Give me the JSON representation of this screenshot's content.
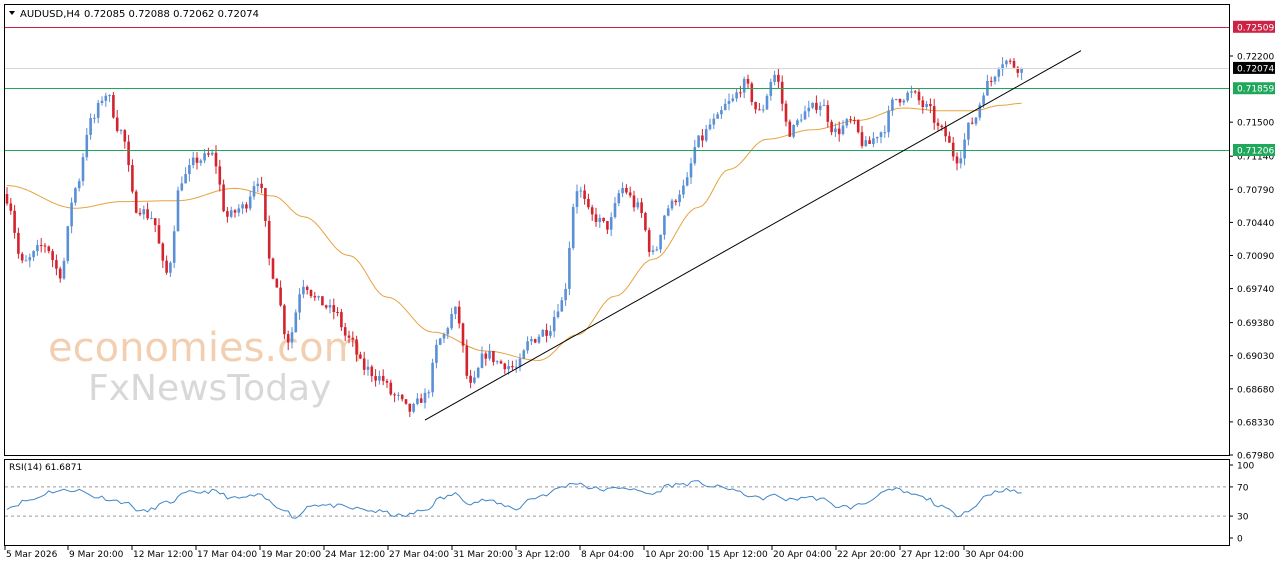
{
  "header": {
    "symbol": "AUDUSD,H4",
    "ohlc": "0.72085 0.72088 0.72062 0.72074"
  },
  "watermark": {
    "line1": "economies.com",
    "line2": "FxNewsToday"
  },
  "colors": {
    "bull": "#5b8fd6",
    "bear": "#d3232d",
    "ma": "#e7a23f",
    "rsi": "#3f86c6",
    "resistance": "#cc2244",
    "support": "#1fa85b",
    "trendline": "#000000",
    "grid": "#d7d7d7",
    "current": "#000000"
  },
  "chart_data": [
    {
      "type": "candlestick",
      "title": "AUDUSD,H4",
      "y_ticks": [
        "0.72200",
        "0.71500",
        "0.71140",
        "0.70790",
        "0.70440",
        "0.70090",
        "0.69740",
        "0.69380",
        "0.69030",
        "0.68680",
        "0.68330",
        "0.67980"
      ],
      "ylim": [
        0.6798,
        0.7275
      ],
      "x_ticks": [
        "5 Mar 2026",
        "9 Mar 20:00",
        "12 Mar 12:00",
        "17 Mar 04:00",
        "19 Mar 20:00",
        "24 Mar 12:00",
        "27 Mar 04:00",
        "31 Mar 20:00",
        "3 Apr 12:00",
        "8 Apr 04:00",
        "10 Apr 20:00",
        "15 Apr 12:00",
        "20 Apr 04:00",
        "22 Apr 20:00",
        "27 Apr 12:00",
        "30 Apr 04:00"
      ],
      "price_levels": [
        {
          "label": "0.72509",
          "value": 0.72509,
          "kind": "resistance"
        },
        {
          "label": "0.72074",
          "value": 0.72074,
          "kind": "current"
        },
        {
          "label": "0.71859",
          "value": 0.71859,
          "kind": "support"
        },
        {
          "label": "0.71206",
          "value": 0.71206,
          "kind": "support"
        }
      ],
      "trendline": {
        "from": {
          "bar": 110,
          "price": 0.6835
        },
        "to": {
          "bar": 266,
          "price": 0.7188
        }
      },
      "moving_average_anchors": [
        [
          0,
          0.7083
        ],
        [
          18,
          0.7059
        ],
        [
          30,
          0.7066
        ],
        [
          45,
          0.7067
        ],
        [
          60,
          0.708
        ],
        [
          70,
          0.7072
        ],
        [
          78,
          0.705
        ],
        [
          90,
          0.7009
        ],
        [
          100,
          0.6965
        ],
        [
          112,
          0.6928
        ],
        [
          126,
          0.6908
        ],
        [
          140,
          0.6898
        ],
        [
          150,
          0.6925
        ],
        [
          160,
          0.6966
        ],
        [
          170,
          0.7005
        ],
        [
          182,
          0.706
        ],
        [
          190,
          0.71
        ],
        [
          200,
          0.7132
        ],
        [
          212,
          0.7142
        ],
        [
          224,
          0.7152
        ],
        [
          236,
          0.7165
        ],
        [
          246,
          0.7162
        ],
        [
          254,
          0.7162
        ],
        [
          262,
          0.7168
        ],
        [
          267,
          0.717
        ]
      ],
      "close_anchors": [
        [
          0,
          0.707
        ],
        [
          4,
          0.7
        ],
        [
          10,
          0.702
        ],
        [
          14,
          0.699
        ],
        [
          18,
          0.708
        ],
        [
          22,
          0.715
        ],
        [
          26,
          0.718
        ],
        [
          30,
          0.714
        ],
        [
          34,
          0.706
        ],
        [
          38,
          0.705
        ],
        [
          42,
          0.699
        ],
        [
          46,
          0.709
        ],
        [
          50,
          0.711
        ],
        [
          54,
          0.7115
        ],
        [
          58,
          0.705
        ],
        [
          62,
          0.706
        ],
        [
          66,
          0.709
        ],
        [
          70,
          0.699
        ],
        [
          74,
          0.692
        ],
        [
          78,
          0.698
        ],
        [
          82,
          0.696
        ],
        [
          86,
          0.695
        ],
        [
          90,
          0.692
        ],
        [
          94,
          0.689
        ],
        [
          98,
          0.688
        ],
        [
          102,
          0.686
        ],
        [
          106,
          0.6845
        ],
        [
          110,
          0.686
        ],
        [
          114,
          0.692
        ],
        [
          118,
          0.695
        ],
        [
          122,
          0.687
        ],
        [
          126,
          0.6905
        ],
        [
          130,
          0.6895
        ],
        [
          134,
          0.689
        ],
        [
          138,
          0.692
        ],
        [
          142,
          0.693
        ],
        [
          146,
          0.696
        ],
        [
          150,
          0.708
        ],
        [
          154,
          0.705
        ],
        [
          158,
          0.704
        ],
        [
          162,
          0.708
        ],
        [
          166,
          0.706
        ],
        [
          170,
          0.701
        ],
        [
          174,
          0.706
        ],
        [
          178,
          0.708
        ],
        [
          182,
          0.713
        ],
        [
          186,
          0.715
        ],
        [
          190,
          0.717
        ],
        [
          194,
          0.719
        ],
        [
          198,
          0.716
        ],
        [
          202,
          0.72
        ],
        [
          206,
          0.714
        ],
        [
          210,
          0.716
        ],
        [
          214,
          0.717
        ],
        [
          218,
          0.714
        ],
        [
          222,
          0.715
        ],
        [
          226,
          0.7125
        ],
        [
          230,
          0.714
        ],
        [
          234,
          0.7175
        ],
        [
          238,
          0.718
        ],
        [
          242,
          0.7165
        ],
        [
          246,
          0.714
        ],
        [
          250,
          0.7112
        ],
        [
          254,
          0.715
        ],
        [
          258,
          0.719
        ],
        [
          262,
          0.7215
        ],
        [
          267,
          0.72074
        ]
      ]
    },
    {
      "type": "line",
      "title": "RSI(14) 61.6871",
      "y_ticks": [
        "100",
        "70",
        "30",
        "0"
      ],
      "ylim": [
        0,
        100
      ],
      "levels": [
        70,
        30
      ],
      "anchors": [
        [
          0,
          42
        ],
        [
          6,
          52
        ],
        [
          12,
          64
        ],
        [
          18,
          66
        ],
        [
          24,
          56
        ],
        [
          30,
          50
        ],
        [
          36,
          36
        ],
        [
          42,
          48
        ],
        [
          48,
          62
        ],
        [
          54,
          64
        ],
        [
          60,
          54
        ],
        [
          66,
          58
        ],
        [
          72,
          42
        ],
        [
          76,
          28
        ],
        [
          80,
          46
        ],
        [
          86,
          44
        ],
        [
          92,
          40
        ],
        [
          98,
          36
        ],
        [
          104,
          30
        ],
        [
          110,
          38
        ],
        [
          114,
          54
        ],
        [
          118,
          60
        ],
        [
          122,
          48
        ],
        [
          126,
          52
        ],
        [
          130,
          46
        ],
        [
          134,
          40
        ],
        [
          138,
          54
        ],
        [
          142,
          60
        ],
        [
          146,
          70
        ],
        [
          150,
          76
        ],
        [
          154,
          68
        ],
        [
          158,
          66
        ],
        [
          162,
          70
        ],
        [
          166,
          64
        ],
        [
          170,
          60
        ],
        [
          174,
          72
        ],
        [
          178,
          74
        ],
        [
          182,
          76
        ],
        [
          186,
          70
        ],
        [
          190,
          68
        ],
        [
          194,
          60
        ],
        [
          198,
          54
        ],
        [
          202,
          58
        ],
        [
          206,
          52
        ],
        [
          210,
          56
        ],
        [
          214,
          54
        ],
        [
          218,
          44
        ],
        [
          222,
          42
        ],
        [
          226,
          48
        ],
        [
          230,
          62
        ],
        [
          234,
          66
        ],
        [
          238,
          60
        ],
        [
          242,
          54
        ],
        [
          246,
          42
        ],
        [
          250,
          32
        ],
        [
          254,
          40
        ],
        [
          258,
          60
        ],
        [
          262,
          66
        ],
        [
          267,
          62
        ]
      ]
    }
  ]
}
